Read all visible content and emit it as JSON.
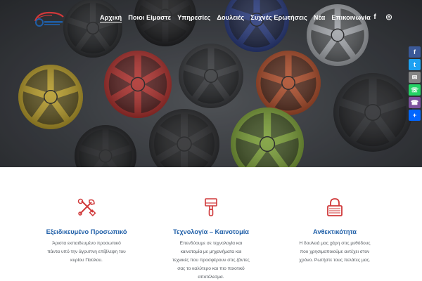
{
  "nav": {
    "items": [
      {
        "label": "Αρχική",
        "active": true
      },
      {
        "label": "Ποιοι Είμαστε"
      },
      {
        "label": "Υπηρεσίες"
      },
      {
        "label": "Δουλειές"
      },
      {
        "label": "Συχνές Ερωτήσεις"
      },
      {
        "label": "Νέα"
      },
      {
        "label": "Επικοινωνία"
      }
    ],
    "social": {
      "facebook": "f",
      "instagram": "◎"
    }
  },
  "share": [
    {
      "icon": "facebook-icon",
      "glyph": "f",
      "color": "#3b5998"
    },
    {
      "icon": "twitter-icon",
      "glyph": "t",
      "color": "#1da1f2"
    },
    {
      "icon": "email-icon",
      "glyph": "✉",
      "color": "#848484"
    },
    {
      "icon": "whatsapp-icon",
      "glyph": "☏",
      "color": "#25d366"
    },
    {
      "icon": "viber-icon",
      "glyph": "☎",
      "color": "#7c529e"
    },
    {
      "icon": "share-icon",
      "glyph": "+",
      "color": "#0166ff"
    }
  ],
  "features": [
    {
      "icon": "tools-icon",
      "title": "Εξειδικευμένο Προσωπικό",
      "lines": [
        "Άριστα εκπαιδευμένο προσωπικό",
        "πάντα υπό την άγρυπνη επίβλεψη του",
        "κυρίου Παύλου."
      ]
    },
    {
      "icon": "paint-brush-icon",
      "title": "Τεχνολογία – Καινοτομία",
      "lines": [
        "Επενδύουμε σε τεχνολογία και",
        "καινοτομία με μηχανήματα και",
        "τεχνικές που προσφέρουν στις ζάντες",
        "σας το καλύτερο και πιο ποιοτικό",
        "αποτέλεσμα."
      ]
    },
    {
      "icon": "lock-icon",
      "title": "Ανθεκτικότητα",
      "lines": [
        "Η δουλειά μας χάρη στις μεθόδους",
        "που χρησιμοποιούμε αντέχει στον",
        "χρόνο. Ρωτήστε τους πελάτες μας."
      ]
    }
  ],
  "colors": {
    "accent": "#1f5fa8",
    "icon_red": "#d0393a",
    "text": "#555a60"
  }
}
